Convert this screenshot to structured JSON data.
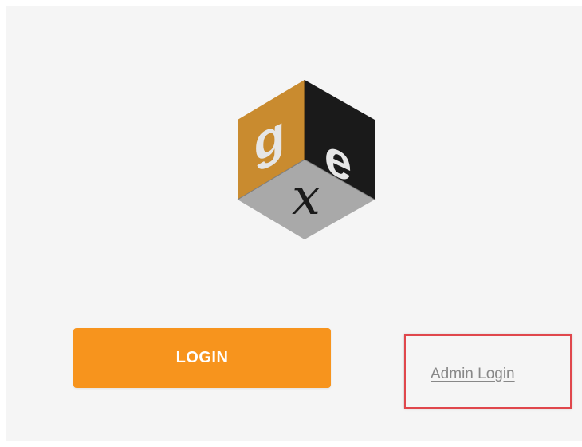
{
  "logo": {
    "letters": [
      "g",
      "e",
      "x"
    ],
    "colors": {
      "left_face": "#c98b2f",
      "right_face": "#1a1a1a",
      "bottom_face": "#a9a9a9"
    }
  },
  "login_button": {
    "label": "LOGIN",
    "color": "#f7941d"
  },
  "admin_login": {
    "label": "Admin Login"
  },
  "highlight": {
    "color": "#e0474c"
  }
}
